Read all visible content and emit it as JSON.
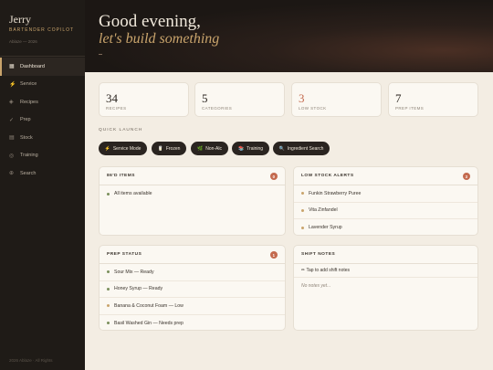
{
  "brand": {
    "name": "Jerry",
    "subtitle": "BARTENDER COPILOT",
    "meta": "Ablaze — 2026"
  },
  "nav": [
    {
      "icon": "▦",
      "label": "Dashboard",
      "active": true
    },
    {
      "icon": "⚡",
      "label": "Service"
    },
    {
      "icon": "◈",
      "label": "Recipes"
    },
    {
      "icon": "✓",
      "label": "Prep"
    },
    {
      "icon": "▤",
      "label": "Stock"
    },
    {
      "icon": "◎",
      "label": "Training"
    },
    {
      "icon": "⊕",
      "label": "Search"
    }
  ],
  "footer": "2026 Ablaze · All Rights",
  "header": {
    "line1": "Good evening,",
    "line2": "let's build something"
  },
  "stats": [
    {
      "value": "34",
      "label": "RECIPES"
    },
    {
      "value": "5",
      "label": "CATEGORIES"
    },
    {
      "value": "3",
      "label": "LOW STOCK"
    },
    {
      "value": "7",
      "label": "PREP ITEMS"
    }
  ],
  "quick_launch": {
    "title": "QUICK LAUNCH",
    "buttons": [
      {
        "icon": "⚡",
        "label": "Service Mode"
      },
      {
        "icon": "🥛",
        "label": "Frozen"
      },
      {
        "icon": "🌿",
        "label": "Non-Alc"
      },
      {
        "icon": "📚",
        "label": "Training"
      },
      {
        "icon": "🔍",
        "label": "Ingredient Search"
      }
    ]
  },
  "eighty_six": {
    "title": "86'D ITEMS",
    "count": "0",
    "items": [
      "All items available"
    ]
  },
  "low_stock": {
    "title": "LOW STOCK ALERTS",
    "count": "3",
    "items": [
      "Funkin Strawberry Puree",
      "Vita Zinfandel",
      "Lavender Syrup"
    ]
  },
  "prep": {
    "title": "PREP STATUS",
    "count": "1",
    "items": [
      {
        "text": "Sour Mix — Ready",
        "status": "ok"
      },
      {
        "text": "Honey Syrup — Ready",
        "status": "ok"
      },
      {
        "text": "Banana & Coconut Foam — Low",
        "status": "low"
      },
      {
        "text": "Basil Washed Gin — Needs prep",
        "status": "ok"
      }
    ]
  },
  "shift_notes": {
    "title": "SHIFT NOTES",
    "tap": "✏ Tap to add shift notes",
    "empty": "No notes yet..."
  },
  "colors": {
    "accent": "#c9a46c",
    "warn": "#c46a4e",
    "ok": "#7a8f5c",
    "dark": "#1f1b17"
  }
}
